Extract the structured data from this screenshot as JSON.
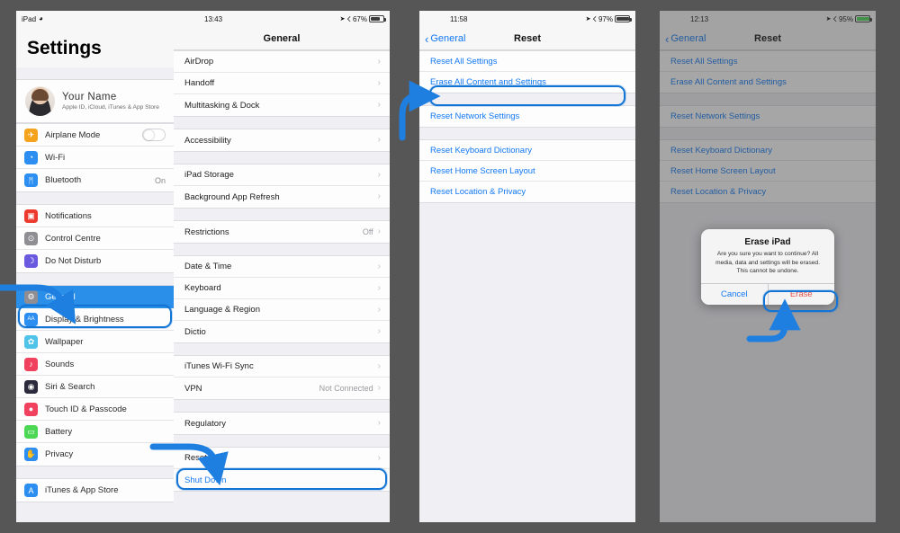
{
  "panels": {
    "settings": {
      "status": {
        "carrier": "iPad",
        "wifi_icon": "wifi-icon"
      },
      "title": "Settings",
      "profile": {
        "name": "Your Name",
        "subtitle": "Apple ID, iCloud, iTunes & App Store"
      },
      "groups": [
        {
          "rows": [
            {
              "label": "Airplane Mode",
              "icon": "airplane-icon",
              "color": "#f5a31c",
              "control": "toggle"
            },
            {
              "label": "Wi-Fi",
              "icon": "wifi-icon",
              "color": "#2b8ef0",
              "control": "chevron"
            },
            {
              "label": "Bluetooth",
              "icon": "bluetooth-icon",
              "color": "#2b8ef0",
              "value": "On",
              "control": "value"
            }
          ]
        },
        {
          "rows": [
            {
              "label": "Notifications",
              "icon": "notifications-icon",
              "color": "#ec3b2e"
            },
            {
              "label": "Control Centre",
              "icon": "control-centre-icon",
              "color": "#8e8e93"
            },
            {
              "label": "Do Not Disturb",
              "icon": "moon-icon",
              "color": "#6a5ae0"
            }
          ]
        },
        {
          "rows": [
            {
              "label": "General",
              "icon": "gear-icon",
              "color": "#8e8e93",
              "selected": true
            },
            {
              "label": "Display & Brightness",
              "icon": "display-icon",
              "color": "#2b8ef0"
            },
            {
              "label": "Wallpaper",
              "icon": "wallpaper-icon",
              "color": "#4fc3e8"
            },
            {
              "label": "Sounds",
              "icon": "sounds-icon",
              "color": "#f0425f"
            },
            {
              "label": "Siri & Search",
              "icon": "siri-icon",
              "color": "#2a2a3c"
            },
            {
              "label": "Touch ID & Passcode",
              "icon": "touchid-icon",
              "color": "#f0425f"
            },
            {
              "label": "Battery",
              "icon": "battery-icon",
              "color": "#4cd755"
            },
            {
              "label": "Privacy",
              "icon": "privacy-icon",
              "color": "#2b8ef0"
            }
          ]
        },
        {
          "rows": [
            {
              "label": "iTunes & App Store",
              "icon": "appstore-icon",
              "color": "#2b8ef0"
            }
          ]
        }
      ]
    },
    "general": {
      "status": {
        "time": "13:43",
        "battery_percent": "67%"
      },
      "title": "General",
      "groups": [
        {
          "rows": [
            {
              "label": "AirDrop",
              "accessory": "chevron"
            },
            {
              "label": "Handoff",
              "accessory": "chevron"
            },
            {
              "label": "Multitasking & Dock",
              "accessory": "chevron"
            }
          ]
        },
        {
          "rows": [
            {
              "label": "Accessibility",
              "accessory": "chevron"
            }
          ]
        },
        {
          "rows": [
            {
              "label": "iPad Storage",
              "accessory": "chevron"
            },
            {
              "label": "Background App Refresh",
              "accessory": "chevron"
            }
          ]
        },
        {
          "rows": [
            {
              "label": "Restrictions",
              "value": "Off",
              "accessory": "chevron"
            }
          ]
        },
        {
          "rows": [
            {
              "label": "Date & Time",
              "accessory": "chevron"
            },
            {
              "label": "Keyboard",
              "accessory": "chevron"
            },
            {
              "label": "Language & Region",
              "accessory": "chevron"
            },
            {
              "label": "Dictio",
              "accessory": "chevron"
            }
          ]
        },
        {
          "rows": [
            {
              "label": "iTunes Wi-Fi Sync",
              "accessory": "chevron"
            },
            {
              "label": "VPN",
              "value": "Not Connected",
              "accessory": "chevron"
            }
          ]
        },
        {
          "rows": [
            {
              "label": "Regulatory",
              "accessory": "chevron"
            }
          ]
        },
        {
          "rows": [
            {
              "label": "Reset",
              "accessory": "chevron",
              "highlighted": true
            },
            {
              "label": "Shut Down",
              "blue": true
            }
          ]
        }
      ]
    },
    "reset": {
      "status": {
        "time": "11:58",
        "battery_percent": "97%"
      },
      "back_label": "General",
      "title": "Reset",
      "groups": [
        {
          "rows": [
            {
              "label": "Reset All Settings"
            },
            {
              "label": "Erase All Content and Settings",
              "highlighted": true
            }
          ]
        },
        {
          "rows": [
            {
              "label": "Reset Network Settings"
            }
          ]
        },
        {
          "rows": [
            {
              "label": "Reset Keyboard Dictionary"
            },
            {
              "label": "Reset Home Screen Layout"
            },
            {
              "label": "Reset Location & Privacy"
            }
          ]
        }
      ]
    },
    "dialog": {
      "status": {
        "time": "12:13",
        "battery_percent": "95%",
        "charging": true
      },
      "back_label": "General",
      "title": "Reset",
      "groups": [
        {
          "rows": [
            {
              "label": "Reset All Settings"
            },
            {
              "label": "Erase All Content and Settings"
            }
          ]
        },
        {
          "rows": [
            {
              "label": "Reset Network Settings"
            }
          ]
        },
        {
          "rows": [
            {
              "label": "Reset Keyboard Dictionary"
            },
            {
              "label": "Reset Home Screen Layout"
            },
            {
              "label": "Reset Location & Privacy"
            }
          ]
        }
      ],
      "alert": {
        "title": "Erase iPad",
        "message": "Are you sure you want to continue? All media, data and settings will be erased. This cannot be undone.",
        "cancel_label": "Cancel",
        "confirm_label": "Erase"
      }
    }
  },
  "annotations": {
    "accent_color": "#1274d4",
    "arrows": [
      {
        "name": "arrow-to-general",
        "target": "General sidebar row"
      },
      {
        "name": "arrow-to-reset",
        "target": "Reset row"
      },
      {
        "name": "arrow-to-erase-all",
        "target": "Erase All Content and Settings"
      },
      {
        "name": "arrow-to-erase-button",
        "target": "Erase alert button"
      }
    ]
  }
}
